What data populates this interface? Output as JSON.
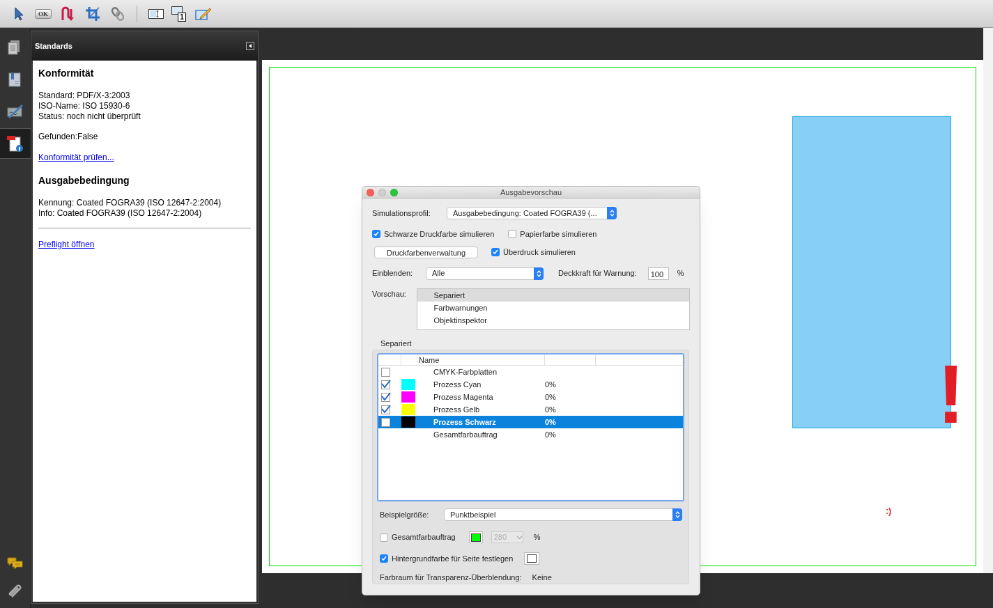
{
  "toolbar": {
    "groups": [
      [
        {
          "kind": "pointer"
        },
        {
          "kind": "ok",
          "label": "OK"
        },
        {
          "kind": "route"
        },
        {
          "kind": "crop"
        },
        {
          "kind": "link"
        }
      ],
      [
        {
          "kind": "text_field"
        },
        {
          "kind": "numbered_field",
          "label": "1"
        },
        {
          "kind": "form_edit"
        }
      ]
    ]
  },
  "sidebar": {
    "top": [
      {
        "kind": "pages",
        "selected": false
      },
      {
        "kind": "bookmarks",
        "selected": false
      },
      {
        "kind": "signatures",
        "selected": false
      },
      {
        "kind": "standards",
        "selected": true
      }
    ],
    "bottom": [
      {
        "kind": "comments"
      },
      {
        "kind": "attachments"
      }
    ]
  },
  "panel": {
    "title": "Standards",
    "sections": [
      {
        "heading": "Konformität",
        "groups": [
          [
            "Standard: PDF/X-3:2003",
            "ISO-Name: ISO 15930-6",
            "Status: noch nicht überprüft"
          ],
          [
            "Gefunden:False"
          ]
        ],
        "link": "Konformität prüfen..."
      },
      {
        "heading": "Ausgabebedingung",
        "groups": [
          [
            "Kennung: Coated FOGRA39 (ISO 12647-2:2004)",
            "Info: Coated FOGRA39 (ISO 12647-2:2004)"
          ]
        ]
      }
    ],
    "footer_link": "Preflight öffnen"
  },
  "page": {
    "exclamation": "!",
    "smiley": ":)"
  },
  "dialog": {
    "title": "Ausgabevorschau",
    "simulation_profile": {
      "label": "Simulationsprofil:",
      "value": "Ausgabebedingung: Coated FOGRA39 (..."
    },
    "simulate_black": {
      "label": "Schwarze Druckfarbe simulieren",
      "checked": true
    },
    "simulate_paper": {
      "label": "Papierfarbe simulieren",
      "checked": false
    },
    "ink_manager": "Druckfarbenverwaltung",
    "simulate_overprint": {
      "label": "Überdruck simulieren",
      "checked": true
    },
    "show": {
      "label": "Einblenden:",
      "value": "Alle"
    },
    "warning_opacity": {
      "label": "Deckkraft für Warnung:",
      "value": "100",
      "unit": "%"
    },
    "preview": {
      "label": "Vorschau:",
      "items": [
        {
          "label": "Separiert",
          "selected": true
        },
        {
          "label": "Farbwarnungen",
          "selected": false
        },
        {
          "label": "Objektinspektor",
          "selected": false
        }
      ]
    },
    "separations": {
      "label": "Separiert",
      "columns": [
        "Name"
      ],
      "rows": [
        {
          "kind": "group",
          "checked": false,
          "name": "CMYK-Farbplatten",
          "selected": false
        },
        {
          "kind": "plate",
          "checked": true,
          "color": "#00ffff",
          "name": "Prozess Cyan",
          "coverage": "0%",
          "selected": false
        },
        {
          "kind": "plate",
          "checked": true,
          "color": "#ff00ff",
          "name": "Prozess Magenta",
          "coverage": "0%",
          "selected": false
        },
        {
          "kind": "plate",
          "checked": true,
          "color": "#ffff00",
          "name": "Prozess Gelb",
          "coverage": "0%",
          "selected": false
        },
        {
          "kind": "plate",
          "checked": false,
          "color": "#000000",
          "name": "Prozess Schwarz",
          "coverage": "0%",
          "selected": true
        },
        {
          "kind": "total",
          "name": "Gesamtfarbauftrag",
          "coverage": "0%",
          "selected": false
        }
      ]
    },
    "sample_size": {
      "label": "Beispielgröße:",
      "value": "Punktbeispiel"
    },
    "total_coverage": {
      "label": "Gesamtfarbauftrag",
      "checked": false,
      "color": "#00ff00",
      "value": "280",
      "unit": "%",
      "disabled": true
    },
    "page_background": {
      "label": "Hintergrundfarbe für Seite festlegen",
      "checked": true,
      "color": "#ffffff"
    },
    "blend_space": {
      "label": "Farbraum für Transparenz-Überblendung:",
      "value": "Keine"
    }
  }
}
